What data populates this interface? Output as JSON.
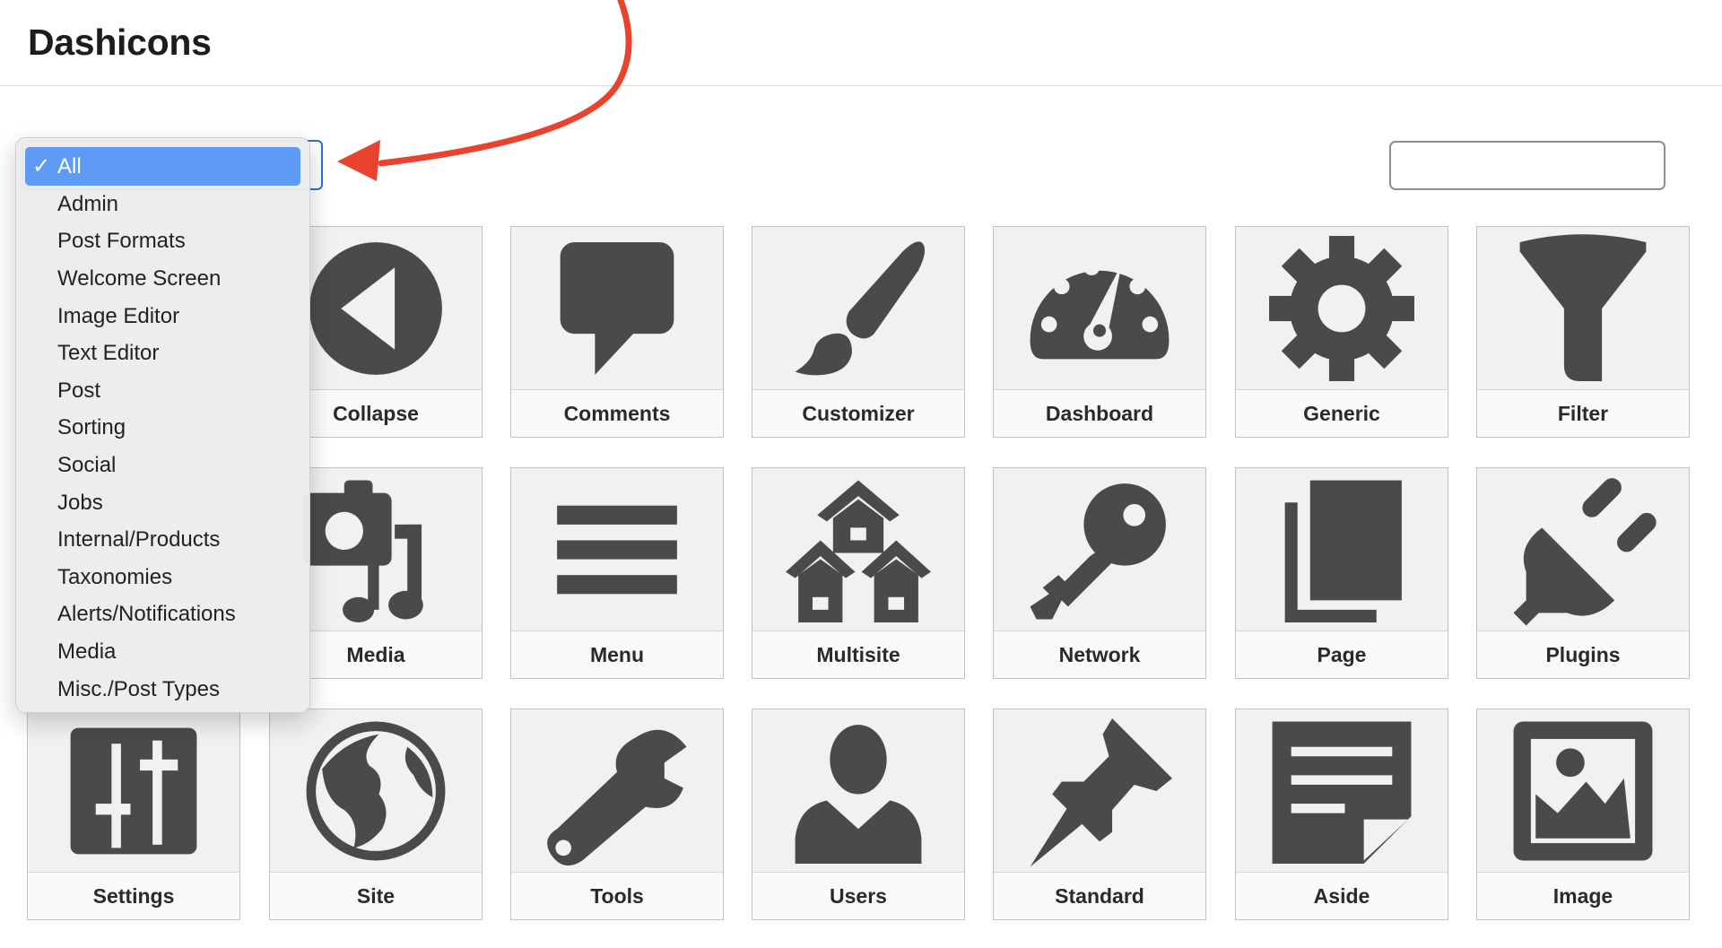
{
  "header": {
    "title": "Dashicons"
  },
  "filter": {
    "selected": "All",
    "options": [
      "All",
      "Admin",
      "Post Formats",
      "Welcome Screen",
      "Image Editor",
      "Text Editor",
      "Post",
      "Sorting",
      "Social",
      "Jobs",
      "Internal/Products",
      "Taxonomies",
      "Alerts/Notifications",
      "Media",
      "Misc./Post Types"
    ]
  },
  "search": {
    "value": ""
  },
  "icons": [
    {
      "label": "Collapse",
      "icon": "collapse-icon"
    },
    {
      "label": "Comments",
      "icon": "comments-icon"
    },
    {
      "label": "Customizer",
      "icon": "customizer-icon"
    },
    {
      "label": "Dashboard",
      "icon": "dashboard-icon"
    },
    {
      "label": "Generic",
      "icon": "generic-icon"
    },
    {
      "label": "Filter",
      "icon": "filter-icon"
    },
    {
      "label": "Media",
      "icon": "media-icon"
    },
    {
      "label": "Menu",
      "icon": "menu-icon"
    },
    {
      "label": "Multisite",
      "icon": "multisite-icon"
    },
    {
      "label": "Network",
      "icon": "network-icon"
    },
    {
      "label": "Page",
      "icon": "page-icon"
    },
    {
      "label": "Plugins",
      "icon": "plugins-icon"
    },
    {
      "label": "Settings",
      "icon": "settings-icon"
    },
    {
      "label": "Site",
      "icon": "site-icon"
    },
    {
      "label": "Tools",
      "icon": "tools-icon"
    },
    {
      "label": "Users",
      "icon": "users-icon"
    },
    {
      "label": "Standard",
      "icon": "standard-icon"
    },
    {
      "label": "Aside",
      "icon": "aside-icon"
    },
    {
      "label": "Image",
      "icon": "image-icon"
    }
  ],
  "colors": {
    "icon": "#4a4a4a",
    "selection": "#5e9bf5",
    "focus": "#2f6fd1",
    "annotation": "#e8432e"
  }
}
